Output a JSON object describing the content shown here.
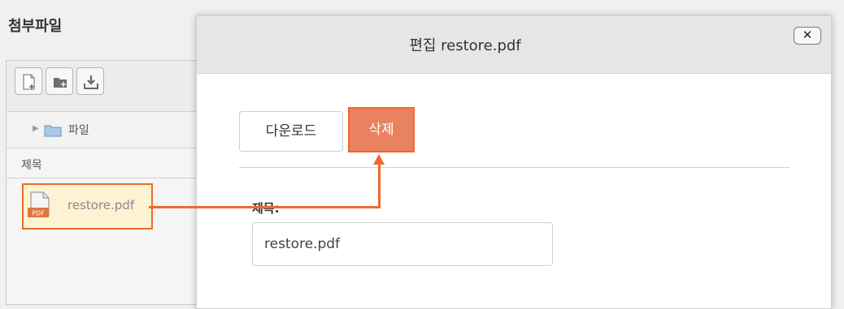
{
  "section_title": "첨부파일",
  "file_manager": {
    "toolbar": {
      "buttons": [
        {
          "icon": "new-file-icon"
        },
        {
          "icon": "new-folder-icon"
        },
        {
          "icon": "download-icon"
        }
      ]
    },
    "breadcrumb": {
      "folder_label": "파일",
      "icon": "folder-icon"
    },
    "column_header": "제목",
    "files": [
      {
        "name": "restore.pdf",
        "icon": "pdf-file-icon",
        "icon_text": "PDF"
      }
    ]
  },
  "dialog": {
    "title": "편집 restore.pdf",
    "close_label": "✕",
    "download_label": "다운로드",
    "delete_label": "삭제",
    "field_label": "제목:",
    "field_value": "restore.pdf"
  },
  "colors": {
    "highlight": "#ef6a2b",
    "delete_button": "#e9835f",
    "selected_file_bg": "#fdf3d3"
  }
}
